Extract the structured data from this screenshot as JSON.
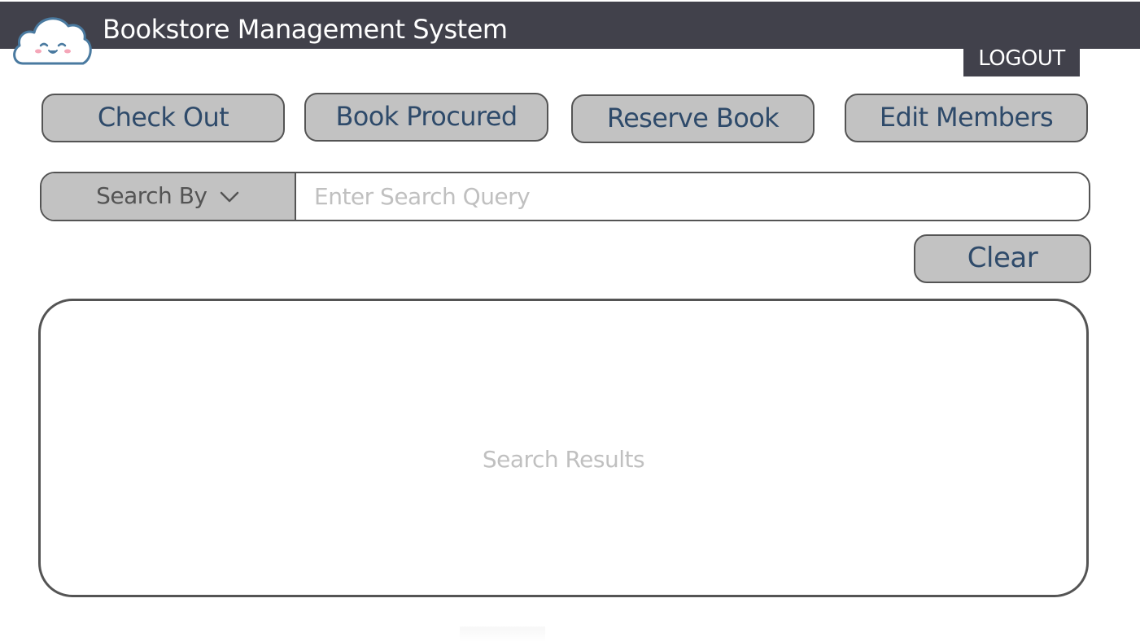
{
  "header": {
    "title": "Bookstore Management System",
    "logout_label": "LOGOUT",
    "logo_icon": "cloud-mascot-icon"
  },
  "nav": {
    "check_out": "Check Out",
    "book_procured": "Book Procured",
    "reserve_book": "Reserve Book",
    "edit_members": "Edit Members"
  },
  "search": {
    "search_by_label": "Search By",
    "placeholder": "Enter Search Query",
    "value": ""
  },
  "actions": {
    "clear_label": "Clear"
  },
  "results": {
    "placeholder": "Search Results"
  },
  "colors": {
    "header_bg": "#41414b",
    "button_bg": "#c2c2c2",
    "button_text": "#2e4a6a",
    "border": "#545454",
    "placeholder": "#c0c0c0"
  }
}
